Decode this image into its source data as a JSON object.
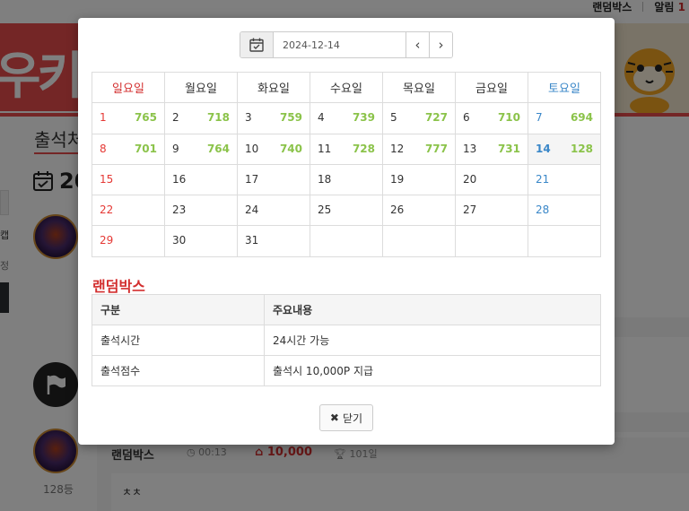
{
  "header": {
    "random_box_link": "랜덤박스",
    "alerts_label": "알림",
    "alerts_count": "1"
  },
  "page": {
    "title": "출석처",
    "date_heading": "20",
    "side_label_1": "캡",
    "side_label_2": "정",
    "rank": "128등",
    "entry": {
      "name": "랜덤박스",
      "time": "00:13",
      "points": "10,000",
      "days": "101일",
      "comment": "ㅊㅊ"
    }
  },
  "modal": {
    "date_value": "2024-12-14",
    "prev_icon": "chevron-left-icon",
    "next_icon": "chevron-right-icon",
    "weekdays": [
      "일요일",
      "월요일",
      "화요일",
      "수요일",
      "목요일",
      "금요일",
      "토요일"
    ],
    "weeks": [
      [
        {
          "d": "1",
          "v": "765"
        },
        {
          "d": "2",
          "v": "718"
        },
        {
          "d": "3",
          "v": "759"
        },
        {
          "d": "4",
          "v": "739"
        },
        {
          "d": "5",
          "v": "727"
        },
        {
          "d": "6",
          "v": "710"
        },
        {
          "d": "7",
          "v": "694"
        }
      ],
      [
        {
          "d": "8",
          "v": "701"
        },
        {
          "d": "9",
          "v": "764"
        },
        {
          "d": "10",
          "v": "740"
        },
        {
          "d": "11",
          "v": "728"
        },
        {
          "d": "12",
          "v": "777"
        },
        {
          "d": "13",
          "v": "731"
        },
        {
          "d": "14",
          "v": "128"
        }
      ],
      [
        {
          "d": "15",
          "v": ""
        },
        {
          "d": "16",
          "v": ""
        },
        {
          "d": "17",
          "v": ""
        },
        {
          "d": "18",
          "v": ""
        },
        {
          "d": "19",
          "v": ""
        },
        {
          "d": "20",
          "v": ""
        },
        {
          "d": "21",
          "v": ""
        }
      ],
      [
        {
          "d": "22",
          "v": ""
        },
        {
          "d": "23",
          "v": ""
        },
        {
          "d": "24",
          "v": ""
        },
        {
          "d": "25",
          "v": ""
        },
        {
          "d": "26",
          "v": ""
        },
        {
          "d": "27",
          "v": ""
        },
        {
          "d": "28",
          "v": ""
        }
      ],
      [
        {
          "d": "29",
          "v": ""
        },
        {
          "d": "30",
          "v": ""
        },
        {
          "d": "31",
          "v": ""
        },
        {
          "d": "",
          "v": ""
        },
        {
          "d": "",
          "v": ""
        },
        {
          "d": "",
          "v": ""
        },
        {
          "d": "",
          "v": ""
        }
      ]
    ],
    "section_title": "랜덤박스",
    "info_headers": [
      "구분",
      "주요내용"
    ],
    "info_rows": [
      [
        "출석시간",
        "24시간 가능"
      ],
      [
        "출석점수",
        "출석시 10,000P 지급"
      ]
    ],
    "close_label": "닫기"
  },
  "colors": {
    "accent_red": "#d32f2f",
    "saturday_blue": "#3a87c8",
    "points_green": "#8bc34a"
  }
}
